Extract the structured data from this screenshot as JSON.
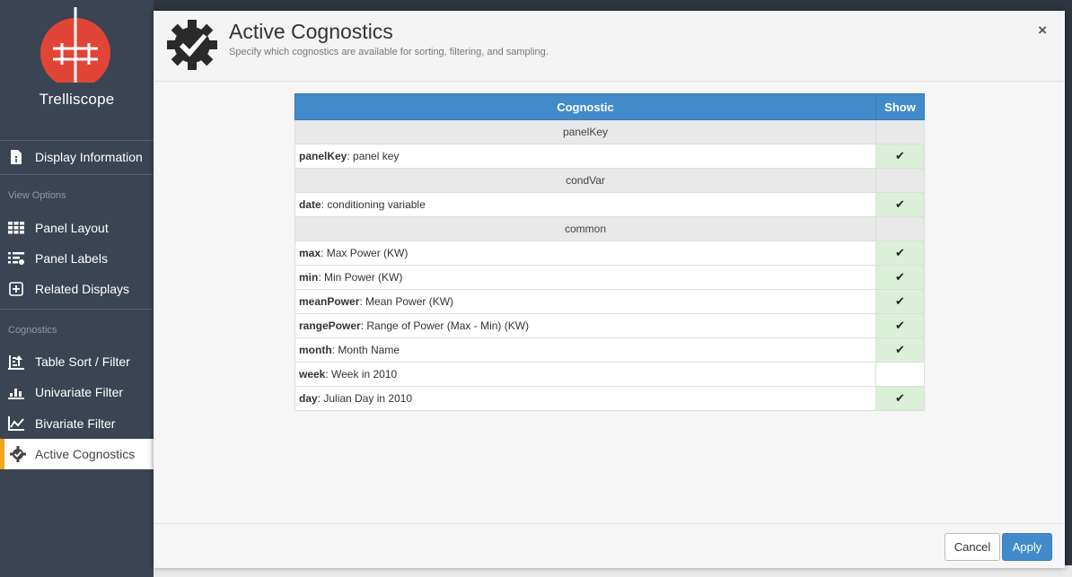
{
  "app": {
    "title": "Trelliscope"
  },
  "sidebar": {
    "display_information": "Display Information",
    "view_options_header": "View Options",
    "panel_layout": "Panel Layout",
    "panel_labels": "Panel Labels",
    "related_displays": "Related Displays",
    "cognostics_header": "Cognostics",
    "table_sort_filter": "Table Sort / Filter",
    "univariate_filter": "Univariate Filter",
    "bivariate_filter": "Bivariate Filter",
    "active_cognostics": "Active Cognostics"
  },
  "modal": {
    "title": "Active Cognostics",
    "subtitle": "Specify which cognostics are available for sorting, filtering, and sampling.",
    "close": "×",
    "table": {
      "col_cognostic": "Cognostic",
      "col_show": "Show",
      "rows": [
        {
          "type": "group",
          "label": "panelKey"
        },
        {
          "type": "item",
          "name": "panelKey",
          "desc": ": panel key",
          "show": true
        },
        {
          "type": "group",
          "label": "condVar"
        },
        {
          "type": "item",
          "name": "date",
          "desc": ": conditioning variable",
          "show": true
        },
        {
          "type": "group",
          "label": "common"
        },
        {
          "type": "item",
          "name": "max",
          "desc": ": Max Power (KW)",
          "show": true
        },
        {
          "type": "item",
          "name": "min",
          "desc": ": Min Power (KW)",
          "show": true
        },
        {
          "type": "item",
          "name": "meanPower",
          "desc": ": Mean Power (KW)",
          "show": true
        },
        {
          "type": "item",
          "name": "rangePower",
          "desc": ": Range of Power (Max - Min) (KW)",
          "show": true
        },
        {
          "type": "item",
          "name": "month",
          "desc": ": Month Name",
          "show": true
        },
        {
          "type": "item",
          "name": "week",
          "desc": ": Week in 2010",
          "show": false
        },
        {
          "type": "item",
          "name": "day",
          "desc": ": Julian Day in 2010",
          "show": true
        }
      ]
    },
    "footer": {
      "cancel": "Cancel",
      "apply": "Apply"
    }
  },
  "colors": {
    "accent": "#428bca",
    "active_marker": "#f0a61f",
    "logo_red": "#e04538",
    "sidebar_bg": "#3b4452",
    "show_on": "#dcefd9"
  },
  "icons": [
    "trelliscope-logo",
    "file-info-icon",
    "grid-icon",
    "labels-icon",
    "plus-square-icon",
    "sort-filter-icon",
    "bar-chart-icon",
    "line-chart-icon",
    "gear-check-icon",
    "checkmark-icon"
  ]
}
